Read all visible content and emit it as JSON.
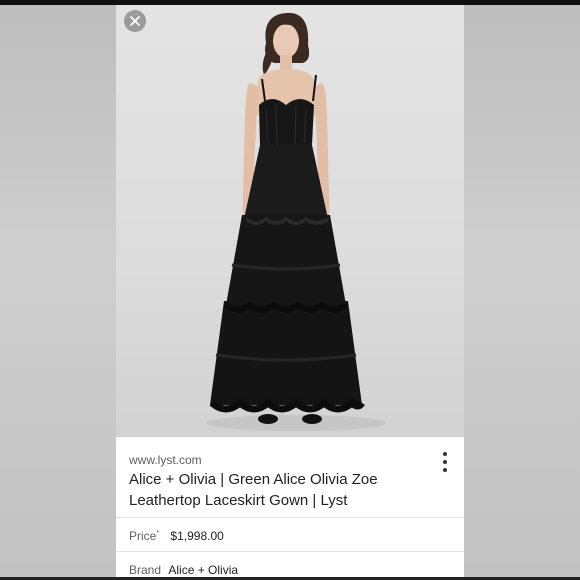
{
  "result": {
    "site": "www.lyst.com",
    "title_line1": "Alice + Olivia | Green Alice Olivia Zoe",
    "title_line2": "Leathertop Laceskirt Gown | Lyst",
    "price_label": "Price",
    "price_mark": "*",
    "price_value": "$1,998.00",
    "brand_label": "Brand",
    "brand_value": "Alice + Olivia"
  },
  "icons": {
    "close": "close-icon",
    "more": "more-vert-icon"
  },
  "colors": {
    "background_side": "#c4c4c4",
    "card": "#ffffff",
    "text_primary": "#222222",
    "text_secondary": "#5f5f5f",
    "dress": "#141414"
  }
}
